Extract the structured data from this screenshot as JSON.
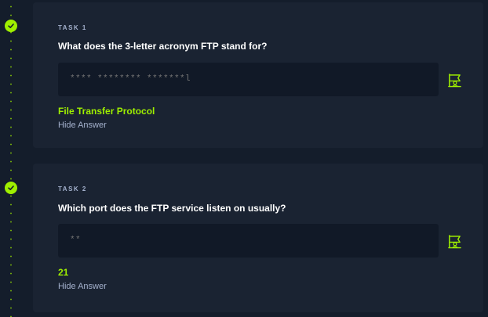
{
  "tasks": [
    {
      "label": "TASK 1",
      "question": "What does the 3-letter acronym FTP stand for?",
      "answer_mask": "**** ******** *******l",
      "answer": "File Transfer Protocol",
      "hide_label": "Hide Answer",
      "completed": true
    },
    {
      "label": "TASK 2",
      "question": "Which port does the FTP service listen on usually?",
      "answer_mask": "**",
      "answer": "21",
      "hide_label": "Hide Answer",
      "completed": true
    }
  ],
  "colors": {
    "background": "#141d2b",
    "card": "#1a2332",
    "input": "#111927",
    "accent": "#9fef00",
    "muted": "#a4b1cd",
    "text": "#ffffff"
  },
  "icons": {
    "completed": "check-icon",
    "submit": "flag-icon"
  }
}
